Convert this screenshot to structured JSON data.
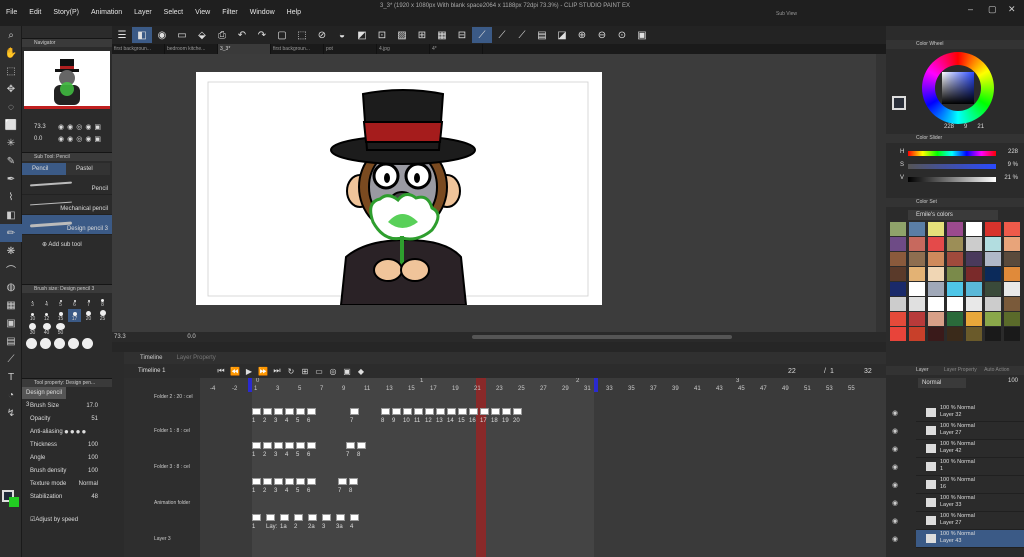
{
  "window": {
    "title": "3_3* (1920 x 1080px With blank space2064 x 1188px 72dpi 73.3%) - CLIP STUDIO PAINT EX",
    "sub_view": "Sub View"
  },
  "menu": [
    "File",
    "Edit",
    "Story(P)",
    "Animation",
    "Layer",
    "Select",
    "View",
    "Filter",
    "Window",
    "Help"
  ],
  "doc_tabs": [
    "first backgroun...",
    "bedroom kitche...",
    "3_3*",
    "first backgroun...",
    "pot",
    "4.jpg",
    "4*"
  ],
  "active_tab_index": 2,
  "navigator": {
    "title": "Navigator",
    "zoom": "73.3",
    "rotation": "0.0"
  },
  "subtool": {
    "panel_title": "Sub Tool: Pencil",
    "tabs": [
      "Pencil",
      "Pastel"
    ],
    "brushes": [
      "Pencil",
      "Mechanical pencil",
      "Design pencil 3"
    ],
    "add_label": "Add sub tool"
  },
  "brush_size": {
    "title": "Brush size: Design pencil 3",
    "sizes": [
      "3",
      "4",
      "5",
      "6",
      "7",
      "8",
      "10",
      "12",
      "15",
      "17",
      "20",
      "25",
      "30",
      "40",
      "50"
    ],
    "selected": "17"
  },
  "tool_property": {
    "title": "Tool property: Design pen...",
    "name": "Design pencil 3",
    "rows": [
      {
        "label": "Brush Size",
        "value": "17.0"
      },
      {
        "label": "Opacity",
        "value": "51"
      },
      {
        "label": "Anti-aliasing",
        "value": ""
      },
      {
        "label": "Thickness",
        "value": "100"
      },
      {
        "label": "Angle",
        "value": "100"
      },
      {
        "label": "Brush density",
        "value": "100"
      },
      {
        "label": "Texture mode",
        "value": "Normal"
      },
      {
        "label": "Stabilization",
        "value": "48"
      }
    ],
    "adjust_speed": "Adjust by speed"
  },
  "canvas_status": {
    "zoom": "73.3",
    "angle": "0.0"
  },
  "timeline": {
    "panel_title": "Timeline",
    "tab2": "Layer Property",
    "name": "Timeline 1",
    "current_frame": "22",
    "total_label": "1",
    "total_frames": "32",
    "frame_numbers": [
      "-4",
      "-2",
      "1",
      "3",
      "5",
      "7",
      "9",
      "11",
      "13",
      "15",
      "17",
      "19",
      "21",
      "23",
      "25",
      "27",
      "29",
      "31",
      "33",
      "35",
      "37",
      "39",
      "41",
      "43",
      "45",
      "47",
      "49",
      "51",
      "53",
      "55"
    ],
    "section_markers": [
      "0",
      "1",
      "2",
      "3"
    ],
    "tracks": [
      {
        "label": "Folder 2 : 20 : cel",
        "cels": [
          "1",
          "2",
          "3",
          "4",
          "5",
          "6",
          "7",
          "8",
          "9",
          "10",
          "11",
          "12",
          "13",
          "14",
          "15",
          "16",
          "17",
          "18",
          "19",
          "20"
        ]
      },
      {
        "label": "Folder 1 : 8 : cel",
        "cels": [
          "1",
          "2",
          "3",
          "4",
          "5",
          "6",
          "7",
          "8"
        ]
      },
      {
        "label": "Folder 3 : 8 : cel",
        "cels": [
          "1",
          "2",
          "3",
          "4",
          "5",
          "6",
          "7",
          "8"
        ]
      },
      {
        "label": "Animation folder",
        "cels": [
          "1",
          "Lay:",
          "1a",
          "2",
          "2a",
          "3",
          "3a",
          "4"
        ]
      },
      {
        "label": "Layer 3",
        "cels": []
      }
    ]
  },
  "color_wheel": {
    "title": "Color Wheel",
    "h": "228",
    "s": "9",
    "v": "21"
  },
  "color_slider": {
    "title": "Color Slider",
    "h_label": "H",
    "s_label": "S",
    "v_label": "V",
    "h": "228",
    "s": "9 %",
    "v": "21 %"
  },
  "color_set": {
    "title": "Color Set",
    "name": "Emile's colors",
    "colors": [
      "#8fa36a",
      "#5a7ea6",
      "#e5e07a",
      "#9b4a8e",
      "#ffffff",
      "#d8332c",
      "#ee5a4a",
      "#6e4b86",
      "#c7695e",
      "#e44a4a",
      "#9c8e57",
      "#cccccc",
      "#b2dde0",
      "#e8a47a",
      "#8a5a3c",
      "#8e6e50",
      "#cf8a5c",
      "#a04a3c",
      "#4a3a5c",
      "#b0b8c8",
      "#5a4a3c",
      "#5a3a2a",
      "#e3b274",
      "#f0d6b4",
      "#7a8a4a",
      "#7a2a2a",
      "#0b2a5a",
      "#e08a3a",
      "#1a2a6a",
      "#ffffff",
      "#a0a8b8",
      "#4ec6e8",
      "#5ab8d8",
      "#3a4a3a",
      "#e8e8e8",
      "#cccccc",
      "#e0e0e0",
      "#ffffff",
      "#ffffff",
      "#e8e8e8",
      "#cccccc",
      "#7a5a3a",
      "#e44a3a",
      "#b83a3a",
      "#d8a088",
      "#2a6a3a",
      "#e8a83a",
      "#8aa84a",
      "#5a6a2a",
      "#e8443a",
      "#c8402a",
      "#3a1a1a",
      "#3a2a1a",
      "#6a5a2a",
      "#1a1a1a",
      "#1a1a1a"
    ]
  },
  "layer_panel": {
    "title": "Layer",
    "tab2": "Layer Property",
    "tab3": "Auto Action",
    "blend": "Normal",
    "opacity": "100",
    "layers": [
      {
        "pct": "100 %",
        "mode": "Normal",
        "name": "Layer 32"
      },
      {
        "pct": "100 %",
        "mode": "Normal",
        "name": "Layer 27"
      },
      {
        "pct": "100 %",
        "mode": "Normal",
        "name": "Layer 42"
      },
      {
        "pct": "100 %",
        "mode": "Normal",
        "name": "1"
      },
      {
        "pct": "100 %",
        "mode": "Normal",
        "name": "16"
      },
      {
        "pct": "100 %",
        "mode": "Normal",
        "name": "Layer 33"
      },
      {
        "pct": "100 %",
        "mode": "Normal",
        "name": "Layer 27"
      },
      {
        "pct": "100 %",
        "mode": "Normal",
        "name": "Layer 43"
      }
    ]
  }
}
